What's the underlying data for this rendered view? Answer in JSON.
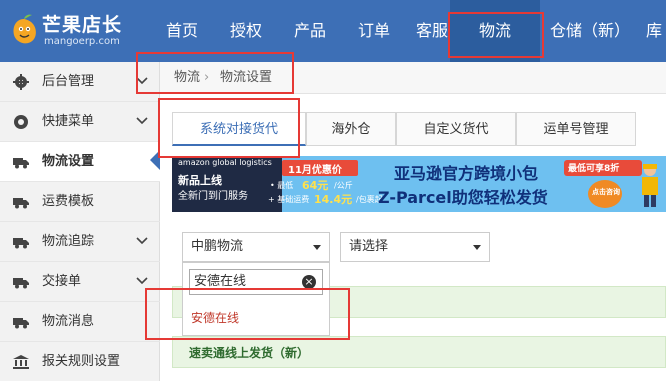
{
  "brand": {
    "name": "芒果店长",
    "url": "mangoerp.com"
  },
  "topnav": [
    "首页",
    "授权",
    "产品",
    "订单",
    "客服",
    "物流",
    "仓储（新）",
    "库"
  ],
  "topnav_active": "物流",
  "sidebar": [
    {
      "icon": "gear-icon",
      "label": "后台管理",
      "chevron": true
    },
    {
      "icon": "gauge-icon",
      "label": "快捷菜单",
      "chevron": true
    },
    {
      "icon": "truck-icon",
      "label": "物流设置",
      "chevron": false,
      "active": true
    },
    {
      "icon": "truck-icon",
      "label": "运费模板",
      "chevron": false
    },
    {
      "icon": "truck-icon",
      "label": "物流追踪",
      "chevron": true
    },
    {
      "icon": "truck-icon",
      "label": "交接单",
      "chevron": true
    },
    {
      "icon": "truck-icon",
      "label": "物流消息",
      "chevron": false
    },
    {
      "icon": "bank-icon",
      "label": "报关规则设置",
      "chevron": false
    }
  ],
  "breadcrumb": {
    "parent": "物流",
    "sep": "›",
    "current": "物流设置"
  },
  "tabs": [
    "系统对接货代",
    "海外仓",
    "自定义货代",
    "运单号管理"
  ],
  "tabs_active": 0,
  "banner": {
    "brand": "amazon global logistics",
    "promo": "11月优惠价",
    "line1": "新品上线",
    "line2": "全新门到门服务",
    "price1_prefix": "• 最低",
    "price1_value": "64元",
    "price1_unit": "/公斤",
    "price2_prefix": "+ 基础运费",
    "price2_value": "14.4元",
    "price2_unit": "/包裹起",
    "headline1": "亚马逊官方跨境小包",
    "headline2": "Z-Parcel助您轻松发货",
    "badge": "最低可享8折",
    "cta": "点击咨询"
  },
  "filters": {
    "carrier_value": "中鹏物流",
    "second_placeholder": "请选择"
  },
  "dropdown": {
    "search_value": "安德在线",
    "option": "安德在线"
  },
  "rows": [
    "速卖通线上发货（新）"
  ]
}
